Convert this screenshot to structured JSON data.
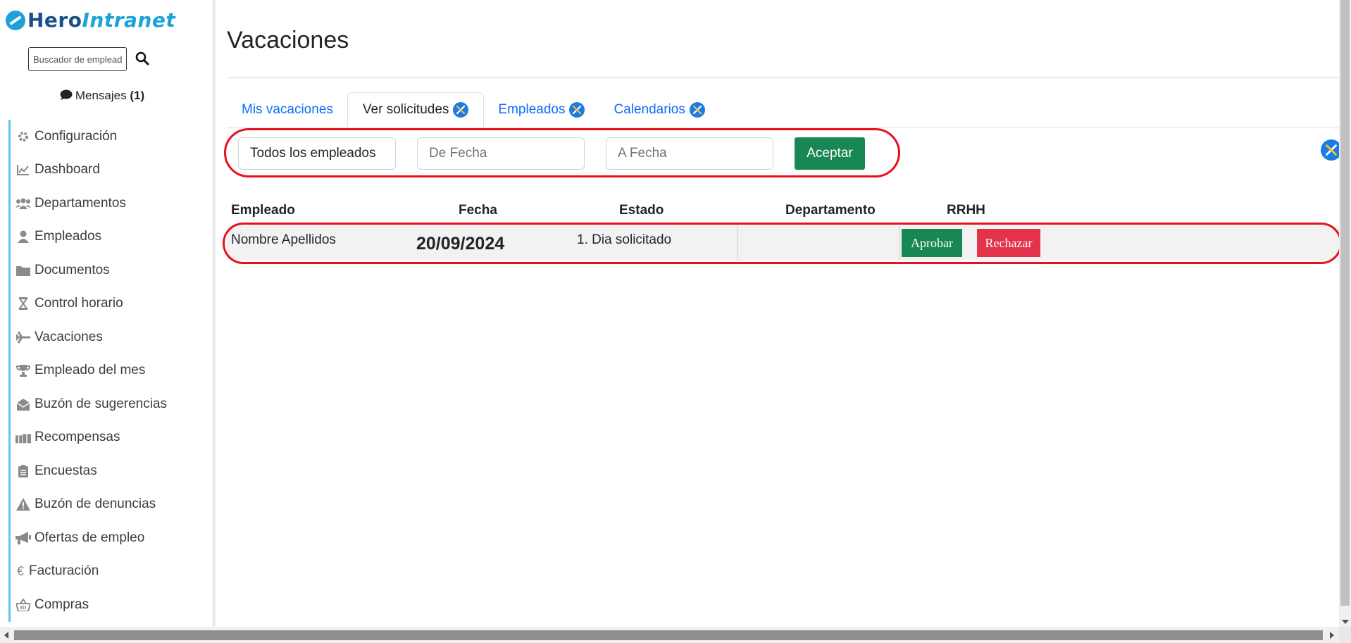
{
  "logo": {
    "hero": "Hero",
    "intranet": "Intranet"
  },
  "search": {
    "placeholder": "Buscador de empleados..."
  },
  "messages": {
    "label": "Mensajes",
    "count": "(1)"
  },
  "sidebar": {
    "items": [
      {
        "label": "Configuración",
        "icon": "gear-icon"
      },
      {
        "label": "Dashboard",
        "icon": "chart-line-icon"
      },
      {
        "label": "Departamentos",
        "icon": "users-icon"
      },
      {
        "label": "Empleados",
        "icon": "user-icon"
      },
      {
        "label": "Documentos",
        "icon": "folder-icon"
      },
      {
        "label": "Control horario",
        "icon": "hourglass-icon"
      },
      {
        "label": "Vacaciones",
        "icon": "plane-icon"
      },
      {
        "label": "Empleado del mes",
        "icon": "trophy-icon"
      },
      {
        "label": "Buzón de sugerencias",
        "icon": "envelope-open-icon"
      },
      {
        "label": "Recompensas",
        "icon": "gifts-icon"
      },
      {
        "label": "Encuestas",
        "icon": "clipboard-list-icon"
      },
      {
        "label": "Buzón de denuncias",
        "icon": "warning-icon"
      },
      {
        "label": "Ofertas de empleo",
        "icon": "bullhorn-icon"
      },
      {
        "label": "Facturación",
        "icon": "euro-icon"
      },
      {
        "label": "Compras",
        "icon": "basket-icon"
      }
    ]
  },
  "page": {
    "title": "Vacaciones"
  },
  "tabs": [
    {
      "label": "Mis vacaciones",
      "active": false,
      "has_tool": false
    },
    {
      "label": "Ver solicitudes",
      "active": true,
      "has_tool": true
    },
    {
      "label": "Empleados",
      "active": false,
      "has_tool": true
    },
    {
      "label": "Calendarios",
      "active": false,
      "has_tool": true
    }
  ],
  "filters": {
    "employee_value": "Todos los empleados",
    "date_from_placeholder": "De Fecha",
    "date_to_placeholder": "A Fecha",
    "accept_label": "Aceptar"
  },
  "table": {
    "headers": {
      "employee": "Empleado",
      "date": "Fecha",
      "state": "Estado",
      "department": "Departamento",
      "rrhh": "RRHH"
    },
    "rows": [
      {
        "employee": "Nombre Apellidos",
        "date": "20/09/2024",
        "state": "1. Dia solicitado",
        "department": "",
        "approve_label": "Aprobar",
        "reject_label": "Rechazar"
      }
    ]
  },
  "colors": {
    "accent": "#0d6efd",
    "brand": "#1da1d8",
    "success": "#198754",
    "danger": "#e3334a",
    "highlight": "#e8101c"
  }
}
